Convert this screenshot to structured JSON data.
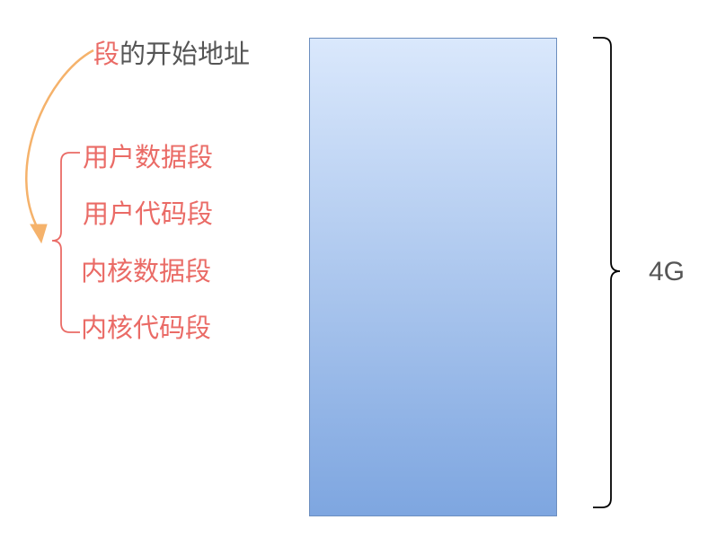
{
  "title": {
    "highlight": "段",
    "rest": "的开始地址"
  },
  "segments": [
    "用户数据段",
    "用户代码段",
    "内核数据段",
    "内核代码段"
  ],
  "memory_size_label": "4G",
  "colors": {
    "highlight_text": "#ea6b66",
    "normal_text": "#555555",
    "arrow": "#f5b26b",
    "bracket_left": "#ea6b66",
    "bracket_right": "#000000",
    "block_border": "#6c8ebf",
    "block_gradient_top": "#dae8fc",
    "block_gradient_bottom": "#7ea6e0"
  }
}
